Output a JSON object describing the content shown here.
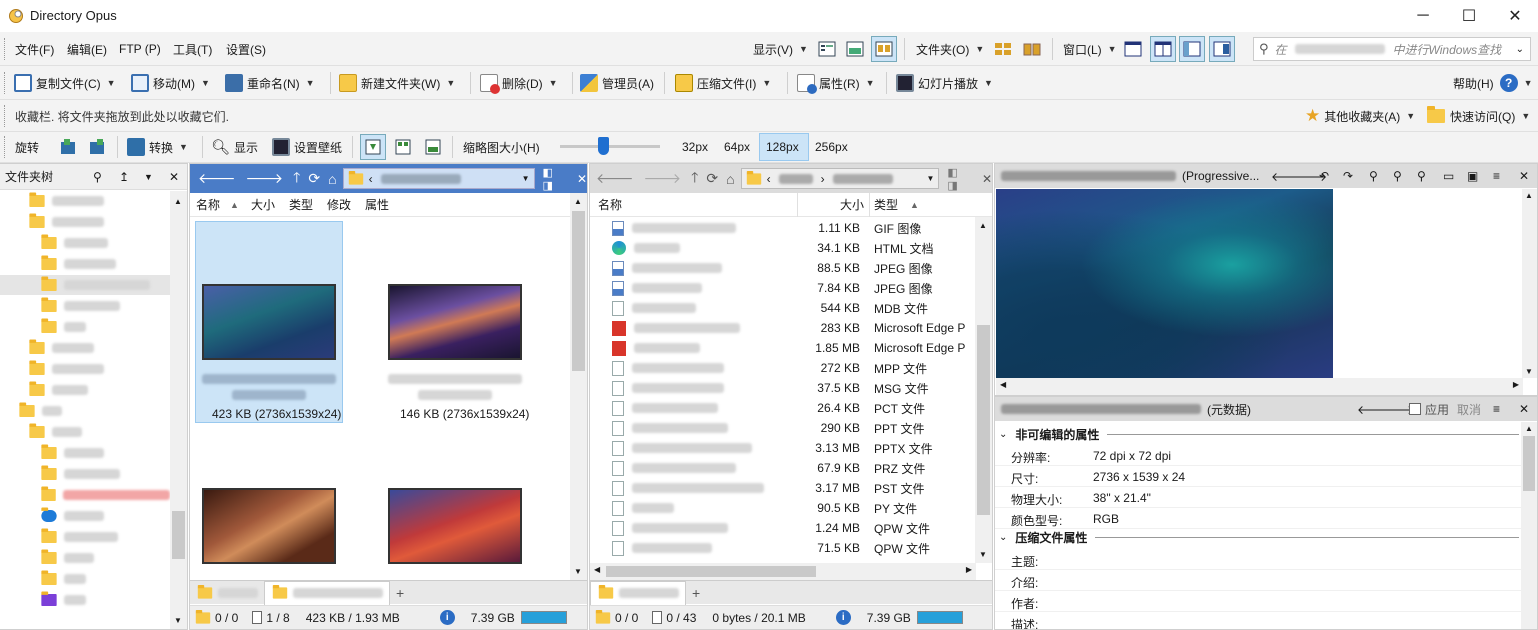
{
  "app": {
    "title": "Directory Opus"
  },
  "menu": {
    "file": "文件(F)",
    "edit": "编辑(E)",
    "ftp": "FTP (P)",
    "tools": "工具(T)",
    "settings": "设置(S)",
    "display": "显示(V)",
    "folders": "文件夹(O)",
    "window": "窗口(L)",
    "search_prefix": "在",
    "search_suffix": "中进行Windows查找"
  },
  "toolbar": {
    "copy": "复制文件(C)",
    "move": "移动(M)",
    "rename": "重命名(N)",
    "newfolder": "新建文件夹(W)",
    "delete": "删除(D)",
    "admin": "管理员(A)",
    "compress": "压缩文件(I)",
    "properties": "属性(R)",
    "slideshow": "幻灯片播放",
    "help": "帮助(H)"
  },
  "favbar": {
    "hint": "收藏栏. 将文件夹拖放到此处以收藏它们.",
    "other": "其他收藏夹(A)",
    "quick": "快速访问(Q)"
  },
  "imagebar": {
    "rotate": "旋转",
    "convert": "转换",
    "show": "显示",
    "wallpaper": "设置壁纸",
    "thumbsize": "缩略图大小(H)",
    "sizes": [
      "32px",
      "64px",
      "128px",
      "256px"
    ],
    "active_size": "128px"
  },
  "tree": {
    "title": "文件夹树"
  },
  "left": {
    "columns": [
      "名称",
      "大小",
      "类型",
      "修改",
      "属性"
    ],
    "thumbs": [
      {
        "info": "423 KB (2736x1539x24)",
        "selected": true
      },
      {
        "info": "146 KB (2736x1539x24)",
        "selected": false
      }
    ],
    "status": {
      "dirs": "0 / 0",
      "files": "1 / 8",
      "size": "423 KB / 1.93 MB",
      "free": "7.39 GB"
    }
  },
  "right": {
    "columns": [
      "名称",
      "大小",
      "类型"
    ],
    "files": [
      {
        "size": "1.11 KB",
        "type": "GIF 图像",
        "icon": "image-icon"
      },
      {
        "size": "34.1 KB",
        "type": "HTML 文档",
        "icon": "edge-icon"
      },
      {
        "size": "88.5 KB",
        "type": "JPEG 图像",
        "icon": "image-icon"
      },
      {
        "size": "7.84 KB",
        "type": "JPEG 图像",
        "icon": "image-icon"
      },
      {
        "size": "544 KB",
        "type": "MDB 文件",
        "icon": "file-icon"
      },
      {
        "size": "283 KB",
        "type": "Microsoft Edge P",
        "icon": "pdf-icon"
      },
      {
        "size": "1.85 MB",
        "type": "Microsoft Edge P",
        "icon": "pdf-icon"
      },
      {
        "size": "272 KB",
        "type": "MPP 文件",
        "icon": "file-icon"
      },
      {
        "size": "37.5 KB",
        "type": "MSG 文件",
        "icon": "file-icon"
      },
      {
        "size": "26.4 KB",
        "type": "PCT 文件",
        "icon": "file-icon"
      },
      {
        "size": "290 KB",
        "type": "PPT 文件",
        "icon": "file-icon"
      },
      {
        "size": "3.13 MB",
        "type": "PPTX 文件",
        "icon": "file-icon"
      },
      {
        "size": "67.9 KB",
        "type": "PRZ 文件",
        "icon": "file-icon"
      },
      {
        "size": "3.17 MB",
        "type": "PST 文件",
        "icon": "file-icon"
      },
      {
        "size": "90.5 KB",
        "type": "PY 文件",
        "icon": "file-icon"
      },
      {
        "size": "1.24 MB",
        "type": "QPW 文件",
        "icon": "file-icon"
      },
      {
        "size": "71.5 KB",
        "type": "QPW 文件",
        "icon": "file-icon"
      }
    ],
    "status": {
      "dirs": "0 / 0",
      "files": "0 / 43",
      "size": "0 bytes / 20.1 MB",
      "free": "7.39 GB"
    }
  },
  "viewer": {
    "title_suffix": "(Progressive..."
  },
  "meta": {
    "title_suffix": "(元数据)",
    "apply": "应用",
    "cancel": "取消",
    "sections": [
      "非可编辑的属性",
      "压缩文件属性"
    ],
    "props": [
      {
        "key": "分辨率:",
        "val": "72 dpi x 72 dpi"
      },
      {
        "key": "尺寸:",
        "val": "2736 x 1539 x 24"
      },
      {
        "key": "物理大小:",
        "val": "38\" x 21.4\""
      },
      {
        "key": "颜色型号:",
        "val": "RGB"
      }
    ],
    "props2": [
      {
        "key": "主题:"
      },
      {
        "key": "介绍:"
      },
      {
        "key": "作者:"
      },
      {
        "key": "描述:"
      }
    ]
  }
}
